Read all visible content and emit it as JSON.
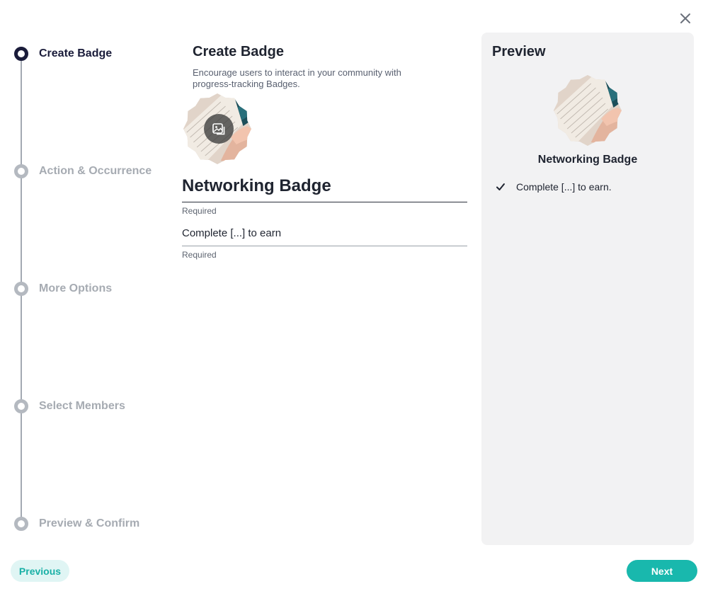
{
  "close_icon": "close-icon",
  "steps": [
    {
      "label": "Create Badge",
      "state": "active"
    },
    {
      "label": "Action & Occurrence",
      "state": "inactive"
    },
    {
      "label": "More Options",
      "state": "inactive"
    },
    {
      "label": "Select Members",
      "state": "inactive"
    },
    {
      "label": "Preview & Confirm",
      "state": "inactive"
    }
  ],
  "form": {
    "title": "Create Badge",
    "description": "Encourage users to interact in your community with progress-tracking Badges.",
    "upload_icon": "image-upload-icon",
    "badge_name_value": "Networking Badge",
    "badge_name_helper": "Required",
    "badge_description_value": "Complete [...] to earn",
    "badge_description_helper": "Required"
  },
  "preview": {
    "title": "Preview",
    "badge_name": "Networking Badge",
    "check_icon": "checkmark-icon",
    "item_text": "Complete [...] to earn."
  },
  "footer": {
    "previous_label": "Previous",
    "next_label": "Next"
  },
  "colors": {
    "accent": "#19b8ad",
    "step_active": "#1a1c3a",
    "step_inactive": "#a6abb2",
    "preview_bg": "#f2f2f3"
  }
}
